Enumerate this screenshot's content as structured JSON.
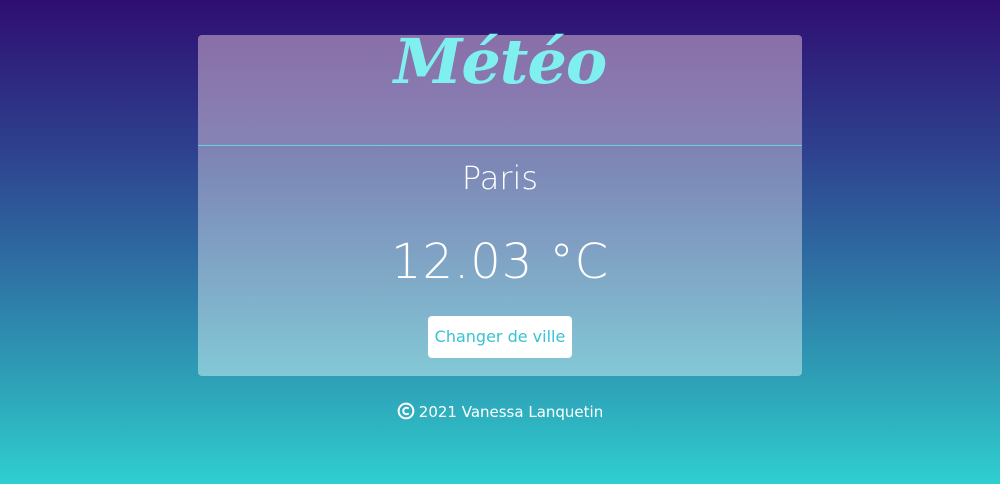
{
  "app": {
    "title": "Météo"
  },
  "weather": {
    "city": "Paris",
    "temperature": "12.03 °C"
  },
  "actions": {
    "change_city_label": "Changer de ville"
  },
  "footer": {
    "copyright_icon": "copyright-icon",
    "text": "2021 Vanessa Lanquetin"
  },
  "colors": {
    "accent": "#7ff0ef",
    "button_text": "#37c3d2",
    "background_top": "#2f0e72",
    "background_bottom": "#2fcfd0"
  }
}
